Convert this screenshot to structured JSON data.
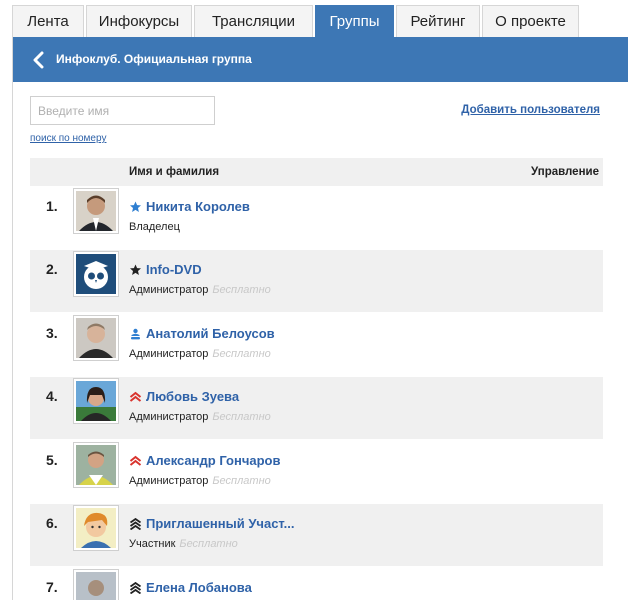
{
  "tabs": [
    {
      "label": "Лента",
      "active": false
    },
    {
      "label": "Инфокурсы",
      "active": false
    },
    {
      "label": "Трансляции",
      "active": false
    },
    {
      "label": "Группы",
      "active": true
    },
    {
      "label": "Рейтинг",
      "active": false
    },
    {
      "label": "О проекте",
      "active": false
    }
  ],
  "header": {
    "title": "Инфоклуб. Официальная группа"
  },
  "search": {
    "placeholder": "Введите имя",
    "value": "",
    "by_number_link": "поиск по номеру"
  },
  "add_user_label": "Добавить пользователя",
  "table": {
    "name_header": "Имя и фамилия",
    "manage_header": "Управление"
  },
  "colors": {
    "accent": "#3d77b5",
    "link": "#2f62a8",
    "owner_star": "#2f7fd1",
    "moderator_chevron": "#d9332d"
  },
  "members": [
    {
      "num": "1.",
      "name": "Никита Королев",
      "role": "Владелец",
      "plan": "",
      "icon": "owner-star-icon",
      "avatar": "person-avatar"
    },
    {
      "num": "2.",
      "name": "Info-DVD",
      "role": "Администратор",
      "plan": "Бесплатно",
      "icon": "admin-star-icon",
      "avatar": "owl-logo-avatar"
    },
    {
      "num": "3.",
      "name": "Анатолий Белоусов",
      "role": "Администратор",
      "plan": "Бесплатно",
      "icon": "person-stack-icon",
      "avatar": "person-avatar"
    },
    {
      "num": "4.",
      "name": "Любовь Зуева",
      "role": "Администратор",
      "plan": "Бесплатно",
      "icon": "red-double-chevron-icon",
      "avatar": "person-avatar"
    },
    {
      "num": "5.",
      "name": "Александр Гончаров",
      "role": "Администратор",
      "plan": "Бесплатно",
      "icon": "red-double-chevron-icon",
      "avatar": "person-avatar"
    },
    {
      "num": "6.",
      "name": "Приглашенный Участ...",
      "role": "Участник",
      "plan": "Бесплатно",
      "icon": "black-triple-chevron-icon",
      "avatar": "drawn-person-avatar"
    },
    {
      "num": "7.",
      "name": "Елена Лобанова",
      "role": "",
      "plan": "",
      "icon": "black-triple-chevron-icon",
      "avatar": "person-avatar"
    }
  ]
}
